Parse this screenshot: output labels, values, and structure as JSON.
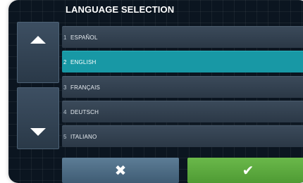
{
  "header": {
    "title": "LANGUAGE SELECTION"
  },
  "nav": {
    "up_icon": "triangle-up-icon",
    "down_icon": "triangle-down-icon"
  },
  "languages": [
    {
      "num": "1",
      "label": "ESPAÑOL",
      "selected": false
    },
    {
      "num": "2",
      "label": "ENGLISH",
      "selected": true
    },
    {
      "num": "3",
      "label": "FRANÇAIS",
      "selected": false
    },
    {
      "num": "4",
      "label": "DEUTSCH",
      "selected": false
    },
    {
      "num": "5",
      "label": "ITALIANO",
      "selected": false
    }
  ],
  "actions": {
    "cancel_icon": "close-icon",
    "cancel_glyph": "✖",
    "confirm_icon": "check-icon",
    "confirm_glyph": "✔"
  },
  "colors": {
    "selected": "#1898a5",
    "confirm": "#5aa83c",
    "cancel": "#4a6a83",
    "background": "#0b1520"
  }
}
